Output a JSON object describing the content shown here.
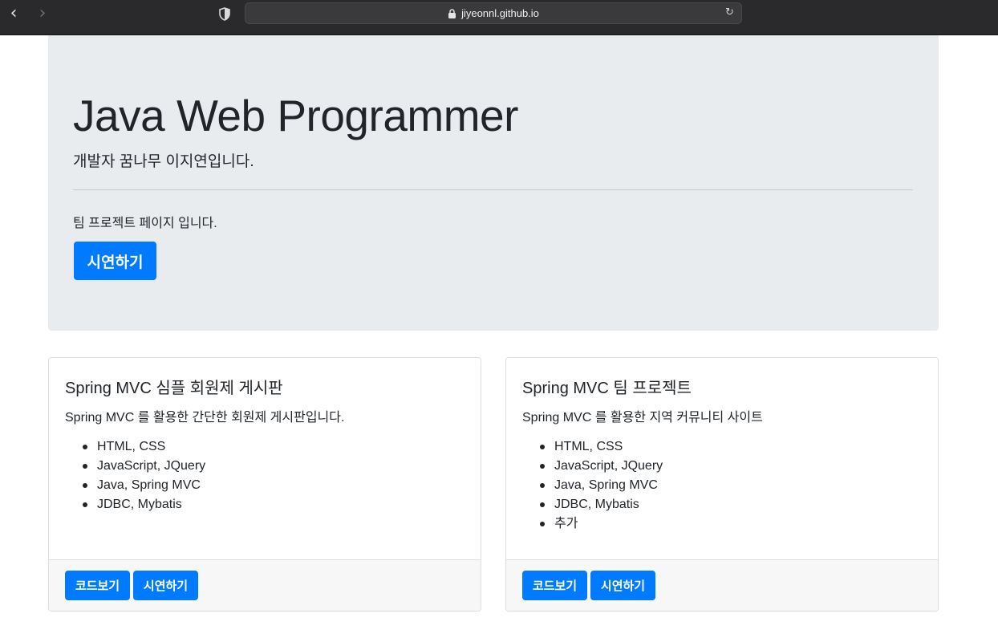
{
  "browser": {
    "url": "jiyeonnl.github.io",
    "back_icon": "chevron-left-icon",
    "forward_icon": "chevron-right-icon",
    "shield_icon": "shield-icon",
    "lock_icon": "lock-icon",
    "reload_icon": "reload-icon"
  },
  "jumbotron": {
    "title": "Java Web Programmer",
    "lead": "개발자 꿈나무 이지연입니다.",
    "text": "팀 프로젝트 페이지 입니다.",
    "button_label": "시연하기"
  },
  "cards": [
    {
      "title": "Spring MVC 심플 회원제 게시판",
      "text": "Spring MVC 를 활용한 간단한 회원제 게시판입니다.",
      "items": [
        "HTML, CSS",
        "JavaScript, JQuery",
        "Java, Spring MVC",
        "JDBC, Mybatis"
      ],
      "code_button": "코드보기",
      "demo_button": "시연하기"
    },
    {
      "title": "Spring MVC 팀 프로젝트",
      "text": "Spring MVC 를 활용한 지역 커뮤니티 사이트",
      "items": [
        "HTML, CSS",
        "JavaScript, JQuery",
        "Java, Spring MVC",
        "JDBC, Mybatis",
        "추가"
      ],
      "code_button": "코드보기",
      "demo_button": "시연하기"
    }
  ],
  "colors": {
    "primary": "#007bff",
    "jumbotron_bg": "#e9ecef",
    "chrome_bg": "#2a2a2c",
    "footer_bg": "#f7f7f7"
  }
}
